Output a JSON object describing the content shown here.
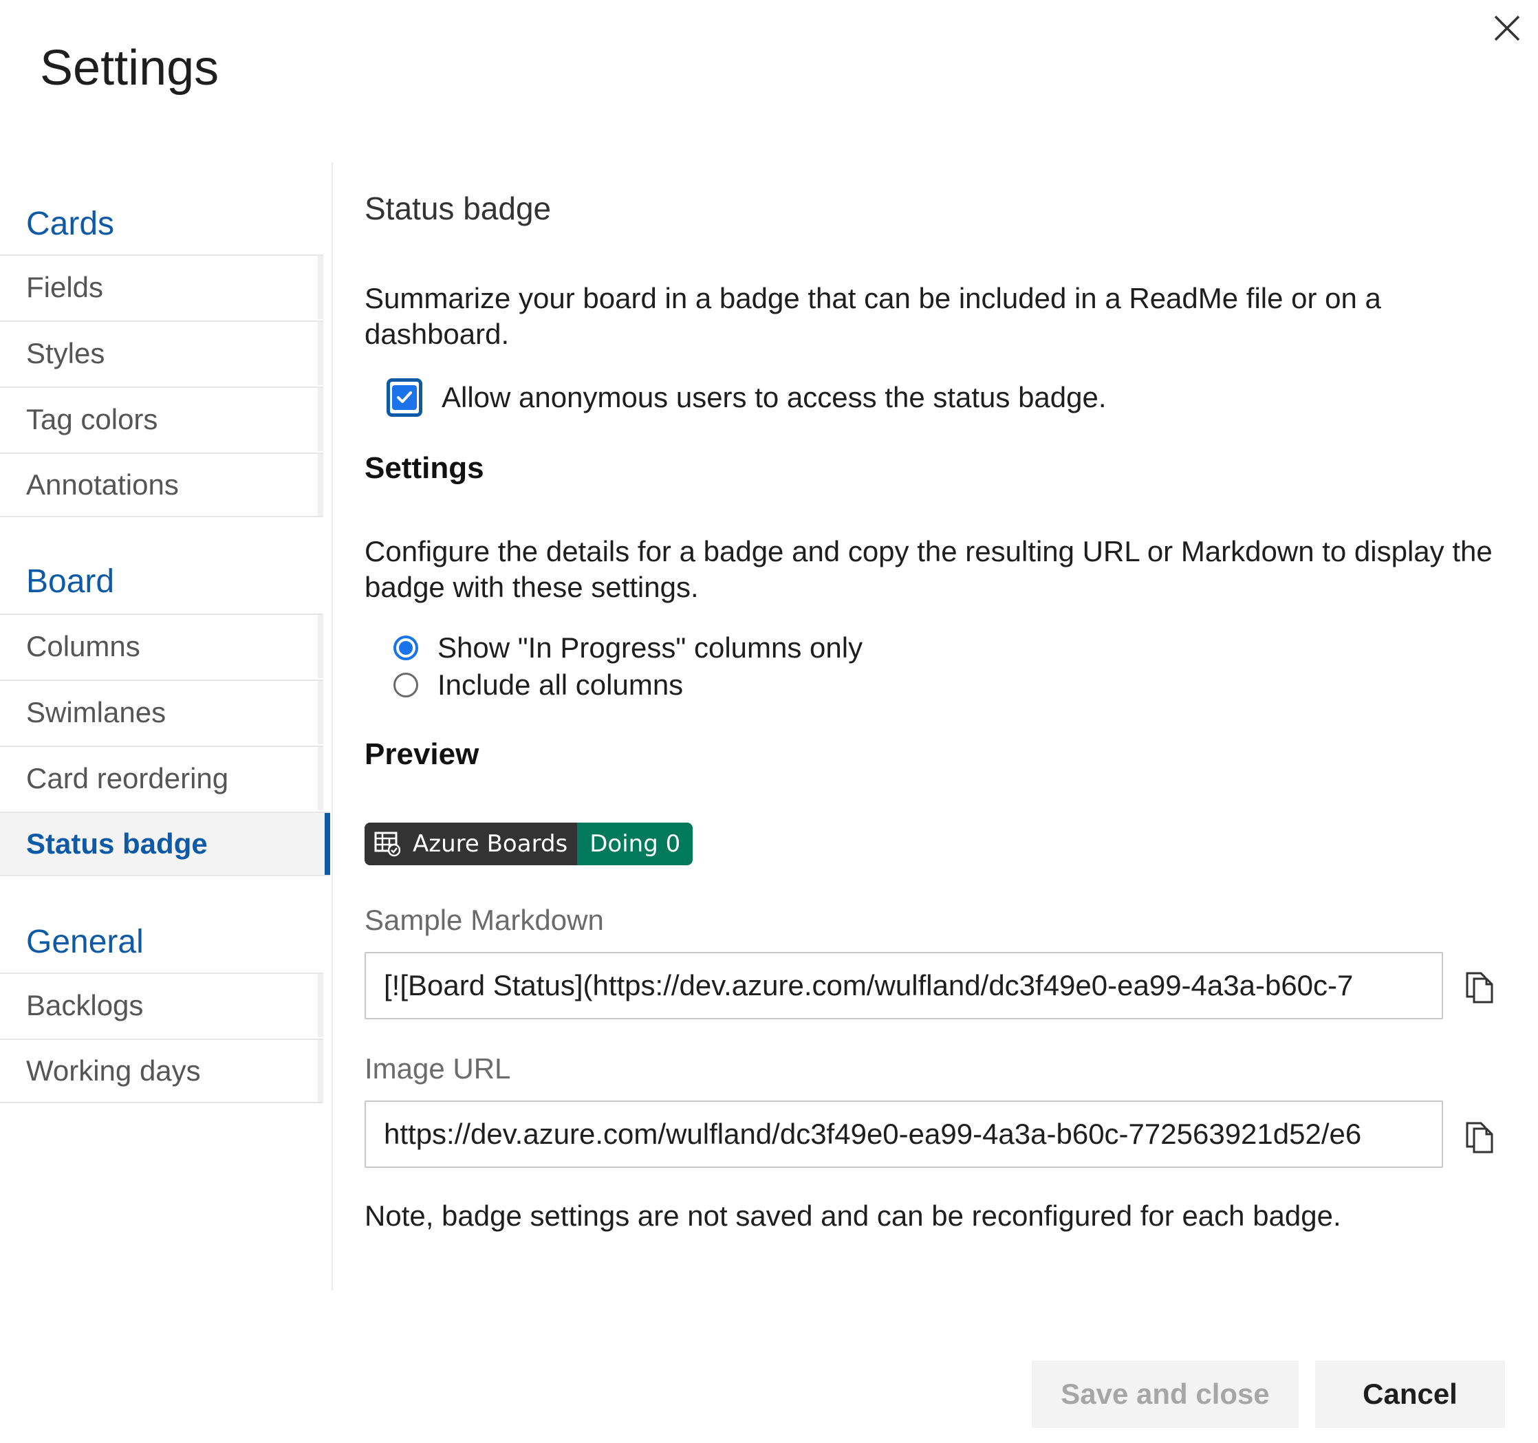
{
  "dialog": {
    "title": "Settings"
  },
  "sidebar": {
    "groups": [
      {
        "title": "Cards",
        "items": [
          "Fields",
          "Styles",
          "Tag colors",
          "Annotations"
        ]
      },
      {
        "title": "Board",
        "items": [
          "Columns",
          "Swimlanes",
          "Card reordering",
          "Status badge"
        ]
      },
      {
        "title": "General",
        "items": [
          "Backlogs",
          "Working days"
        ]
      }
    ],
    "selected_item": "Status badge"
  },
  "main": {
    "section_title": "Status badge",
    "description": "Summarize your board in a badge that can be included in a ReadMe file or on a dashboard.",
    "anonymous_checkbox": {
      "label": "Allow anonymous users to access the status badge.",
      "checked": true
    },
    "settings_heading": "Settings",
    "settings_description": "Configure the details for a badge and copy the resulting URL or Markdown to display the badge with these settings.",
    "radio_options": [
      {
        "label": "Show \"In Progress\" columns only",
        "selected": true
      },
      {
        "label": "Include all columns",
        "selected": false
      }
    ],
    "preview_heading": "Preview",
    "badge": {
      "left_text": "Azure Boards",
      "right_text": "Doing 0",
      "left_color": "#333333",
      "right_color": "#007a5a"
    },
    "sample_markdown": {
      "label": "Sample Markdown",
      "value": "[![Board Status](https://dev.azure.com/wulfland/dc3f49e0-ea99-4a3a-b60c-7"
    },
    "image_url": {
      "label": "Image URL",
      "value": "https://dev.azure.com/wulfland/dc3f49e0-ea99-4a3a-b60c-772563921d52/e6"
    },
    "note": "Note, badge settings are not saved and can be reconfigured for each badge."
  },
  "footer": {
    "save_label": "Save and close",
    "cancel_label": "Cancel"
  },
  "colors": {
    "accent": "#0f5aa6",
    "checkbox": "#1a73e8"
  }
}
